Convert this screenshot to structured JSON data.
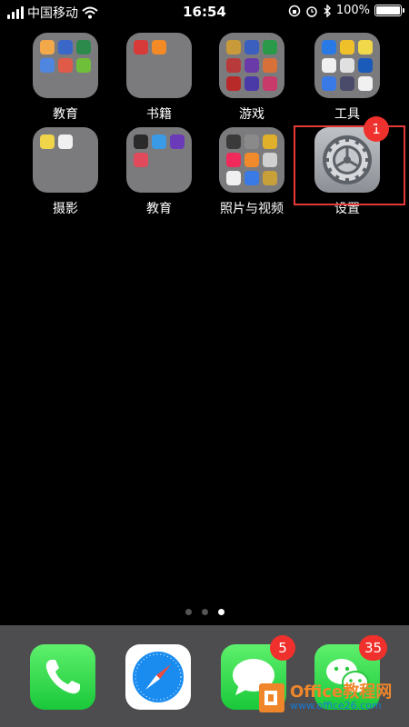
{
  "status_bar": {
    "carrier": "中国移动",
    "time": "16:54",
    "battery": "100%",
    "battery_level": 1.0
  },
  "home": {
    "row1": [
      {
        "label": "教育",
        "mini_colors": [
          "#f3a84a",
          "#3b67c9",
          "#2d8a4d",
          "#4f86e0",
          "#e05a4a",
          "#6fbf3a"
        ]
      },
      {
        "label": "书籍",
        "mini_colors": [
          "#d83a3a",
          "#f28a26"
        ]
      },
      {
        "label": "游戏",
        "mini_colors": [
          "#c89a3a",
          "#3a5fbf",
          "#2a9a4a",
          "#b83a3a",
          "#6a3aa8",
          "#d8703a",
          "#b82a2a",
          "#4a3aa8",
          "#c83a6a"
        ]
      },
      {
        "label": "工具",
        "mini_colors": [
          "#2a7ae6",
          "#f0c02a",
          "#f0d84a",
          "#f0f0f0",
          "#e0e0e0",
          "#1a5ab8",
          "#3a7ae6",
          "#4a4a6a",
          "#f0f0f0"
        ]
      }
    ],
    "row2": [
      {
        "label": "摄影",
        "mini_colors": [
          "#f0d44a",
          "#f0f0f0"
        ]
      },
      {
        "label": "教育",
        "mini_colors": [
          "#2a2a2a",
          "#3a9ae6",
          "#6a3ab8",
          "#e04a5a"
        ]
      },
      {
        "label": "照片与视频",
        "mini_colors": [
          "#3a3a3a",
          "#8a8a8a",
          "#e0b02a",
          "#f02a5a",
          "#f08a2a",
          "#d0d0d0",
          "#f0f0f0",
          "#3a7ae6",
          "#c8a03a"
        ]
      },
      {
        "label": "设置",
        "badge": "1"
      }
    ]
  },
  "page_dots": {
    "count": 3,
    "active_index": 2
  },
  "dock": {
    "messages_badge": "5",
    "wechat_badge": "35"
  },
  "watermark": {
    "title": "Office教程网",
    "url": "www.office26.com"
  },
  "colors": {
    "background": "#000000",
    "badge": "#f0302c",
    "highlight": "#e53935",
    "dock": "#4d4d4f"
  }
}
